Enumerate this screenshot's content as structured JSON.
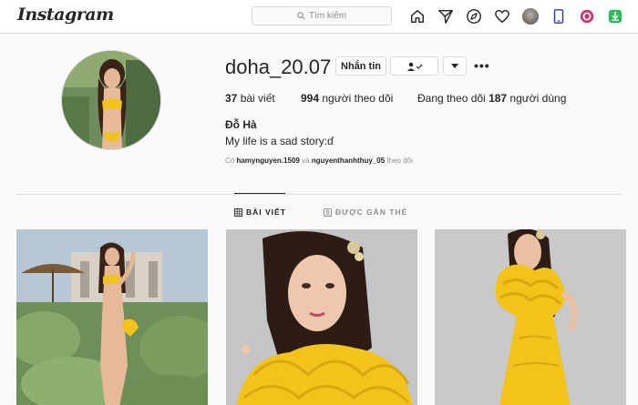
{
  "nav": {
    "logo": "Instagram",
    "search_placeholder": "Tìm kiếm",
    "icons": [
      "home-icon",
      "direct-icon",
      "explore-icon",
      "activity-icon",
      "profile-avatar",
      "device-icon",
      "instagram-ext-icon",
      "download-ext-icon"
    ]
  },
  "profile": {
    "username": "doha_20.07",
    "message_button": "Nhắn tin",
    "posts_count": "37",
    "posts_label": " bài viết",
    "followers_count": "994",
    "followers_label": " người theo dõi",
    "following_prefix": "Đang theo dõi ",
    "following_count": "187",
    "following_label": " người dùng",
    "full_name": "Đỗ Hà",
    "bio": "My life is a sad story:ɗ",
    "followed_by_prefix": "Có ",
    "followed_by_user1": "hamynguyen.1509",
    "followed_by_and": " và ",
    "followed_by_user2": "nguyenthanhthuy_05",
    "followed_by_suffix": " theo dõi"
  },
  "tabs": {
    "posts": "BÀI VIẾT",
    "tagged": "ĐƯỢC GẮN THẺ"
  },
  "colors": {
    "accent_yellow": "#f2c31a",
    "text": "#262626",
    "muted": "#8e8e8e",
    "border": "#dbdbdb"
  }
}
